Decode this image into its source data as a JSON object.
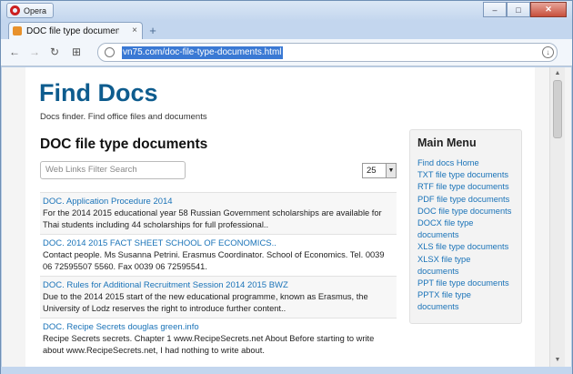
{
  "browser": {
    "menu_label": "Opera",
    "tab_title": "DOC file type documents",
    "tab_close": "×",
    "new_tab": "+",
    "url": "vn75.com/doc-file-type-documents.html",
    "controls": {
      "minimize": "–",
      "maximize": "□",
      "close": "✕"
    },
    "nav": {
      "back": "←",
      "forward": "→",
      "reload": "↻",
      "speed_dial": "⊞"
    }
  },
  "site": {
    "title": "Find Docs",
    "description": "Docs finder. Find office files and documents"
  },
  "content": {
    "heading": "DOC file type documents",
    "filter_placeholder": "Web Links Filter Search",
    "limit_value": "25",
    "items": [
      {
        "title": "DOC. Application Procedure 2014",
        "desc": "For the 2014 2015 educational year 58 Russian Government scholarships are available for Thai students including 44 scholarships for full professional.."
      },
      {
        "title": "DOC. 2014 2015 FACT SHEET SCHOOL OF ECONOMICS..",
        "desc": "Contact people. Ms Susanna Petrini. Erasmus Coordinator. School of Economics. Tel. 0039 06 72595507 5560. Fax 0039 06 72595541."
      },
      {
        "title": "DOC. Rules for Additional Recruitment Session 2014 2015 BWZ",
        "desc": "Due to the 2014 2015 start of the new educational programme, known as Erasmus, the University of Lodz reserves the right to introduce further content.."
      },
      {
        "title": "DOC. Recipe Secrets douglas green.info",
        "desc": "Recipe Secrets secrets. Chapter 1 www.RecipeSecrets.net About Before starting to write about www.RecipeSecrets.net, I had nothing to write about."
      }
    ]
  },
  "menu": {
    "title": "Main Menu",
    "links": [
      "Find docs Home",
      "TXT file type documents",
      "RTF file type documents",
      "PDF file type documents",
      "DOC file type documents",
      "DOCX file type documents",
      "XLS file type documents",
      "XLSX file type documents",
      "PPT file type documents",
      "PPTX file type documents"
    ]
  }
}
